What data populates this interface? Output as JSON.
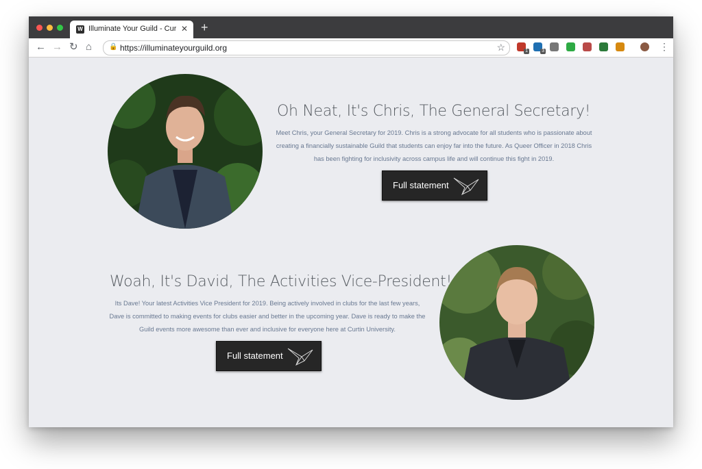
{
  "browser": {
    "tab_title": "Illuminate Your Guild - Curtin S",
    "tab_favicon": "W",
    "url": "https://illuminateyourguild.org",
    "new_tab_symbol": "+",
    "close_symbol": "✕",
    "extensions": [
      {
        "name": "shield-extension",
        "color": "#c0392b",
        "badge": "1"
      },
      {
        "name": "s-extension",
        "color": "#1f6fb2",
        "badge": "3"
      },
      {
        "name": "list-extension",
        "color": "#777777",
        "badge": ""
      },
      {
        "name": "plus-extension",
        "color": "#2eaa44",
        "badge": ""
      },
      {
        "name": "clip-extension",
        "color": "#b94a48",
        "badge": ""
      },
      {
        "name": "leaf-extension",
        "color": "#2c7a3a",
        "badge": ""
      },
      {
        "name": "wallet-extension",
        "color": "#d68910",
        "badge": ""
      }
    ]
  },
  "sections": [
    {
      "title": "Oh Neat, It's Chris, The General Secretary!",
      "text": "Meet Chris, your General Secretary for 2019. Chris is a strong advocate for all students who is passionate about creating a financially  sustainable Guild that students can enjoy far into the future. As Queer Officer in 2018 Chris has been fighting for inclusivity across campus life and will continue this fight in 2019.",
      "button_label": "Full statement"
    },
    {
      "title": "Woah, It's David, The Activities Vice-President!",
      "text": "Its Dave! Your latest Activities Vice President for 2019. Being actively involved in clubs for the last few years, Dave is committed to making events for clubs easier and better in the upcoming year. Dave is ready to make the Guild events more awesome than ever and inclusive for everyone here at Curtin University.",
      "button_label": "Full statement"
    }
  ]
}
